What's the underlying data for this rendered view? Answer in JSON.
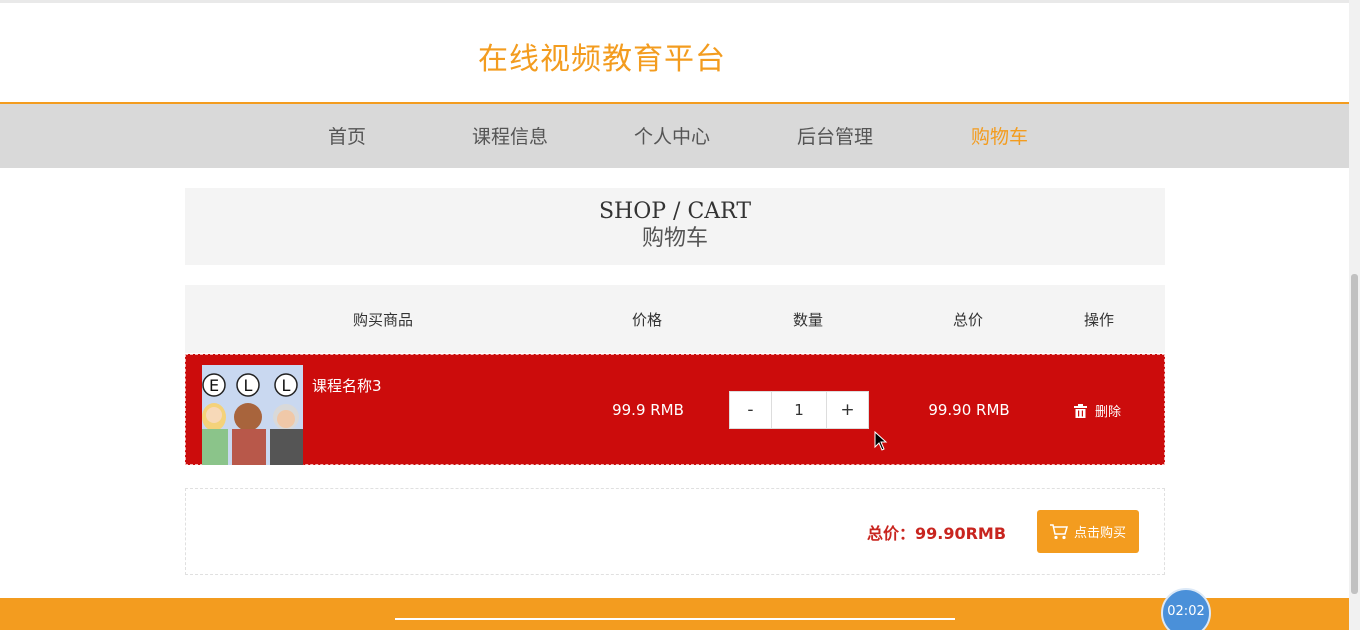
{
  "site": {
    "title": "在线视频教育平台"
  },
  "nav": {
    "items": [
      {
        "label": "首页"
      },
      {
        "label": "课程信息"
      },
      {
        "label": "个人中心"
      },
      {
        "label": "后台管理"
      },
      {
        "label": "购物车"
      }
    ],
    "active": "购物车"
  },
  "cart_header": {
    "en": "SHOP / CART",
    "cn": "购物车"
  },
  "table": {
    "headers": [
      "购买商品",
      "价格",
      "数量",
      "总价",
      "操作"
    ],
    "rows": [
      {
        "name": "课程名称3",
        "thumb_letters": [
          "E",
          "L",
          "L"
        ],
        "price": "99.9 RMB",
        "quantity": "1",
        "total": "99.90 RMB",
        "minus_label": "-",
        "plus_label": "+",
        "delete_label": "删除"
      }
    ]
  },
  "summary": {
    "total_text": "总价：99.90RMB",
    "buy_label": "点击购买"
  },
  "timer": {
    "text": "02:02"
  },
  "colors": {
    "accent": "#f39c1f",
    "row_bg": "#cc0c0c",
    "total_text": "#c8251f",
    "nav_bg": "#d9d9d9"
  }
}
